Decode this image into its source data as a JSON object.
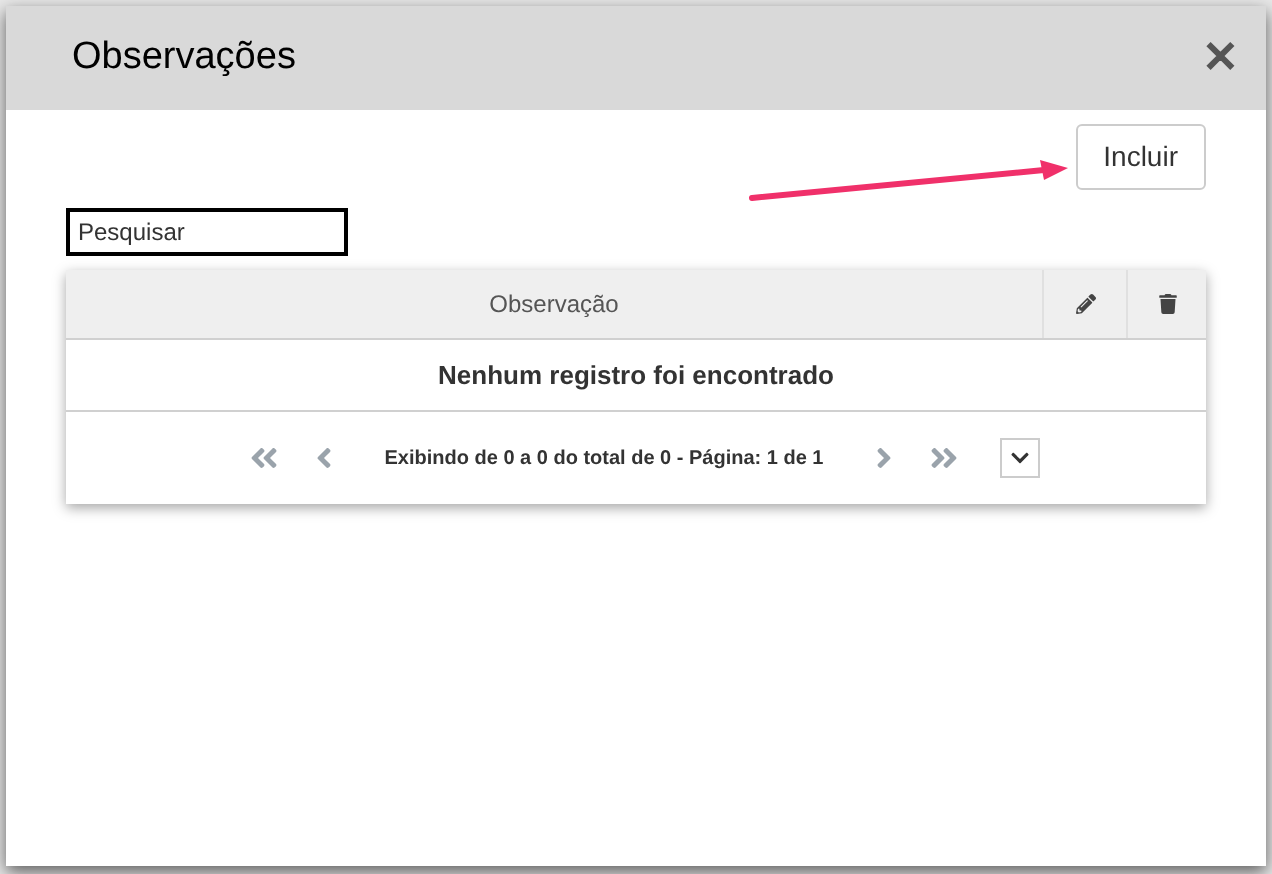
{
  "dialog": {
    "title": "Observações",
    "close": "✕"
  },
  "add_button": "Incluir",
  "search": {
    "placeholder": "Pesquisar"
  },
  "table": {
    "columns": [
      "Observação"
    ],
    "empty_message": "Nenhum registro foi encontrado"
  },
  "pagination": {
    "summary": "Exibindo de 0 a 0 do total de 0 - Página: 1 de 1"
  }
}
